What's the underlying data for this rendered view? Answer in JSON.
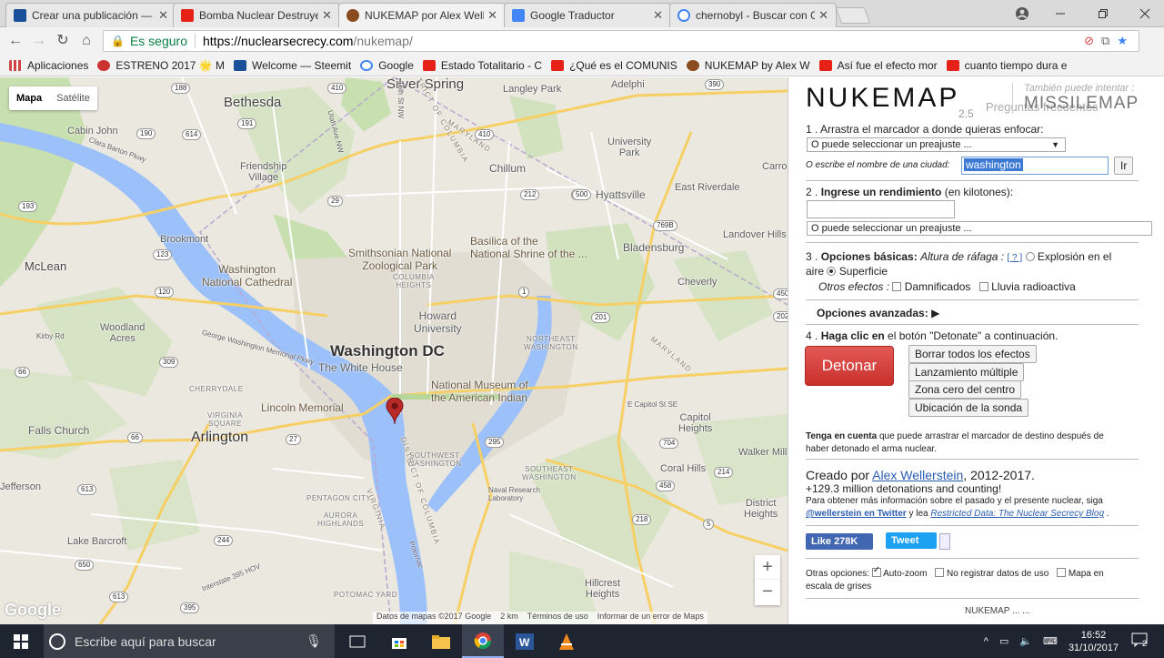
{
  "browser": {
    "tabs": [
      {
        "title": "Crear una publicación —",
        "icon": "steemit-icon",
        "color": "#1a5099"
      },
      {
        "title": "Bomba Nuclear Destruye",
        "icon": "youtube-icon",
        "color": "#e62117"
      },
      {
        "title": "NUKEMAP por Alex Welle",
        "icon": "nukemap-icon",
        "color": "#8a4b1f"
      },
      {
        "title": "Google Traductor",
        "icon": "translate-icon",
        "color": "#4285f4"
      },
      {
        "title": "chernobyl - Buscar con G",
        "icon": "google-icon",
        "color": "#4285f4"
      }
    ],
    "secure_label": "Es seguro",
    "url_host": "https://nuclearsecrecy.com",
    "url_path": "/nukemap/",
    "bookmarks": [
      {
        "label": "Aplicaciones",
        "icon": "apps-icon",
        "color": "#c44"
      },
      {
        "label": "ESTRENO 2017 🌟 M",
        "icon": "tomato-icon",
        "color": "#c33"
      },
      {
        "label": "Welcome — Steemit",
        "icon": "steemit-icon",
        "color": "#1a5099"
      },
      {
        "label": "Google",
        "icon": "google-icon",
        "color": "#4285f4"
      },
      {
        "label": "Estado Totalitario - C",
        "icon": "youtube-icon",
        "color": "#e62117"
      },
      {
        "label": "¿Qué es el COMUNIS",
        "icon": "youtube-icon",
        "color": "#e62117"
      },
      {
        "label": "NUKEMAP by Alex W",
        "icon": "nukemap-icon",
        "color": "#8a4b1f"
      },
      {
        "label": "Así fue el efecto mor",
        "icon": "youtube-icon",
        "color": "#e62117"
      },
      {
        "label": "cuanto tiempo dura e",
        "icon": "youtube-icon",
        "color": "#e62117"
      }
    ]
  },
  "map": {
    "type_map": "Mapa",
    "type_satellite": "Satélite",
    "labels": {
      "bethesda": "Bethesda",
      "silver_spring": "Silver Spring",
      "langley_park": "Langley Park",
      "adelphi": "Adelphi",
      "cabin_john": "Cabin John",
      "clara_barton": "Clara Barton Pkwy",
      "friendship_village": "Friendship\nVillage",
      "university_park": "University\nPark",
      "carro": "Carro",
      "chillum": "Chillum",
      "hyattsville": "Hyattsville",
      "east_riverdale": "East Riverdale",
      "brookmont": "Brookmont",
      "mclean": "McLean",
      "zoo": "Smithsonian National\nZoological Park",
      "basilica": "Basilica of the\nNational Shrine of the ...",
      "bladensburg": "Bladensburg",
      "landover_hills": "Landover Hills",
      "cathedral": "Washington\nNational Cathedral",
      "columbia_heights": "COLUMBIA\nHEIGHTS",
      "cheverly": "Cheverly",
      "howard": "Howard\nUniversity",
      "woodland_acres": "Woodland\nAcres",
      "kirby_rd": "Kirby Rd",
      "gw_parkway": "George Washington Memorial Pkwy",
      "washington_dc": "Washington DC",
      "white_house": "The White House",
      "museum": "National Museum of\nthe American Indian",
      "northeast": "NORTHEAST\nWASHINGTON",
      "cherrydale": "CHERRYDALE",
      "lincoln": "Lincoln Memorial",
      "arlington": "Arlington",
      "virginia_square": "VIRGINIA\nSQUARE",
      "falls_church": "Falls Church",
      "capitol_heights": "Capitol\nHeights",
      "southwest": "SOUTHWEST\nWASHINGTON",
      "southeast": "SOUTHEAST\nWASHINGTON",
      "walker_mill": "Walker Mill",
      "coral_hills": "Coral Hills",
      "jefferson": "Jefferson",
      "pentagon_city": "PENTAGON CITY",
      "aurora_highlands": "AURORA\nHIGHLANDS",
      "district_heights": "District\nHeights",
      "lake_barcroft": "Lake Barcroft",
      "naval_research": "Naval Research\nLaboratory",
      "hillcrest": "Hillcrest\nHeights",
      "interstate": "Interstate 395 HOV",
      "potomac_yard": "POTOMAC YARD",
      "potomac": "Potomac",
      "dist_columbia": "DISTRICT OF COLUMBIA",
      "maryland": "MARYLAND",
      "virginia": "VIRGINIA",
      "e_capitol": "E Capitol St SE",
      "sixteenth": "16th St NW",
      "utah": "Utah Ave NW"
    },
    "shields": [
      "188",
      "410",
      "390",
      "193",
      "29",
      "1",
      "50",
      "295",
      "395",
      "66",
      "120",
      "123",
      "309",
      "27",
      "613",
      "244",
      "214",
      "458",
      "704",
      "218",
      "5",
      "202",
      "614",
      "190",
      "191",
      "212",
      "500",
      "410",
      "769B",
      "201",
      "193",
      "450",
      "650"
    ],
    "footer": [
      "Datos de mapas ©2017 Google",
      "2 km",
      "Términos de uso",
      "Informar de un error de Maps"
    ],
    "google": "Google",
    "zoom_in": "+",
    "zoom_out": "−"
  },
  "nukemap": {
    "title": "NUKEMAP",
    "version": "2.5",
    "faq": "Preguntas frecuentes",
    "also_try": "También puede intentar :",
    "missilemap": "MISSILEMAP",
    "step1_num": "1 .",
    "step1": "Arrastra el marcador a donde quieras enfocar:",
    "preset_target": "O puede seleccionar un preajuste ...",
    "city_label": "O escribe el nombre de una ciudad:",
    "city_value": "washington",
    "go": "Ir",
    "step2_num": "2 .",
    "step2_bold": "Ingrese un rendimiento",
    "step2_rest": " (en kilotones):",
    "yield_value": "",
    "preset_yield": "O puede seleccionar un preajuste ...",
    "step3_num": "3 .",
    "step3_bold": "Opciones básicas:",
    "burst_height": "Altura de ráfaga :",
    "help": "[ ? ]",
    "airburst": "Explosión en el",
    "airburst2": "aire",
    "surface": "Superficie",
    "other_effects": "Otros efectos :",
    "casualties": "Damnificados",
    "fallout": "Lluvia radioactiva",
    "advanced": "Opciones avanzadas:",
    "step4_num": "4 .",
    "step4_bold": "Haga clic en",
    "step4_rest": " el botón \"Detonate\" a continuación.",
    "detonate": "Detonar",
    "clear": "Borrar todos los efectos",
    "multi": "Lanzamiento múltiple",
    "ground_zero": "Zona cero del centro",
    "probe": "Ubicación de la sonda",
    "note_bold": "Tenga en cuenta",
    "note_rest": " que puede arrastrar el marcador de destino después de",
    "note_line2": "haber detonado el arma nuclear.",
    "created_by": "Creado por",
    "author": "Alex Wellerstein",
    "years": ", 2012-2017.",
    "detonations": "+129.3 million detonations and counting!",
    "more_info": "Para obtener más información sobre el pasado y el presente nuclear, siga",
    "twitter_handle": "@wellerstein en Twitter",
    "and_read": " y lea ",
    "blog": "Restricted Data: The Nuclear Secrecy Blog",
    "period": " .",
    "like": "Like 278K",
    "tweet": "Tweet",
    "other_options": "Otras opciones:",
    "autozoom": "Auto-zoom",
    "no_log": "No registrar datos de uso",
    "grayscale": "Mapa en",
    "grayscale2": "escala de grises",
    "cutoff": "NUKEMAP  ...  ..."
  },
  "taskbar": {
    "search": "Escribe aquí para buscar",
    "time": "16:52",
    "date": "31/10/2017",
    "notifications": "2"
  }
}
